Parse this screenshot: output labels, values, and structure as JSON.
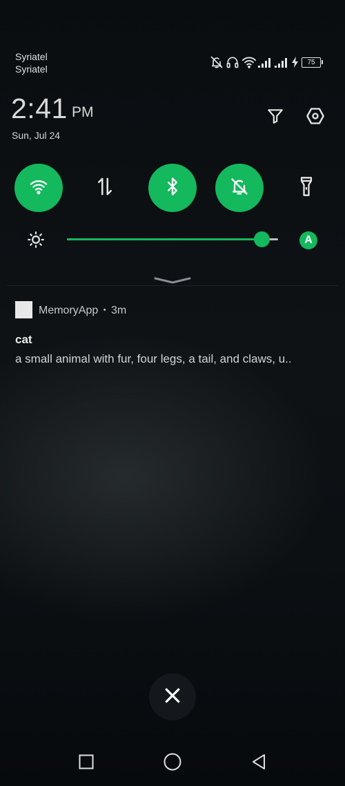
{
  "status_bar": {
    "carrier_line1": "Syriatel",
    "carrier_line2": "Syriatel",
    "battery_level": "75",
    "icons": [
      "bell-off-icon",
      "headset-icon",
      "wifi-signal-icon",
      "cell-signal-1-icon",
      "cell-signal-2-icon",
      "charging-icon",
      "battery-icon"
    ]
  },
  "header": {
    "time": "2:41",
    "ampm": "PM",
    "date": "Sun, Jul 24",
    "actions": [
      "filter-icon",
      "settings-icon"
    ]
  },
  "quick_settings": {
    "accent_color": "#14b85d",
    "toggles": [
      {
        "name": "wifi",
        "icon": "wifi-icon",
        "active": true
      },
      {
        "name": "mobile-data",
        "icon": "data-transfer-icon",
        "active": false
      },
      {
        "name": "bluetooth",
        "icon": "bluetooth-icon",
        "active": true
      },
      {
        "name": "silent-mode",
        "icon": "bell-off-icon",
        "active": true
      },
      {
        "name": "flashlight",
        "icon": "flashlight-icon",
        "active": false
      }
    ],
    "brightness": {
      "level": 0.92,
      "auto_label": "A",
      "icon": "sun-icon"
    }
  },
  "notifications": [
    {
      "app_name": "MemoryApp",
      "separator": "•",
      "time_ago": "3m",
      "title": "cat",
      "text": "a small animal with fur, four legs, a tail, and claws, u.."
    }
  ],
  "dismiss_all": {
    "icon": "close-icon"
  },
  "nav_bar": {
    "buttons": [
      "recents-icon",
      "home-icon",
      "back-icon"
    ]
  }
}
